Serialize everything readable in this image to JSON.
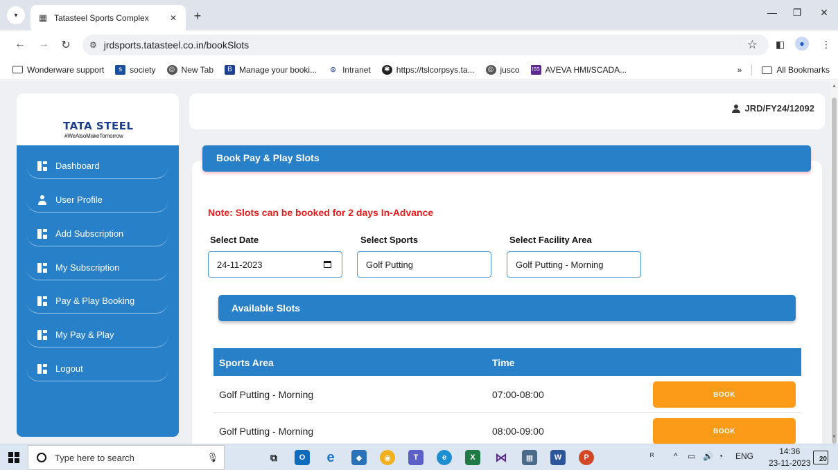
{
  "browser": {
    "tab_title": "Tatasteel Sports Complex",
    "url": "jrdsports.tatasteel.co.in/bookSlots",
    "bookmarks": [
      {
        "label": "Wonderware support",
        "icon": "folder-icon",
        "color": "#444444"
      },
      {
        "label": "society",
        "icon": "society-icon",
        "color": "#1a4fa0"
      },
      {
        "label": "New Tab",
        "icon": "chrome-icon",
        "color": "#555555"
      },
      {
        "label": "Manage your booki...",
        "icon": "booking-icon",
        "color": "#1f3f8f"
      },
      {
        "label": "Intranet",
        "icon": "tata-icon",
        "color": "#1d3d8c"
      },
      {
        "label": "https://tslcorpsys.ta...",
        "icon": "globe-icon",
        "color": "#222222"
      },
      {
        "label": "jusco",
        "icon": "chrome-icon",
        "color": "#555555"
      },
      {
        "label": "AVEVA HMI/SCADA...",
        "icon": "iss-icon",
        "color": "#5b2a8c"
      }
    ],
    "bookmarks_overflow": "»",
    "all_bookmarks": "All Bookmarks"
  },
  "app": {
    "logo": "TATA STEEL",
    "tagline": "#WeAlsoMakeTomorrow",
    "user_id": "JRD/FY24/12092",
    "accent_color": "#2880c8"
  },
  "sidebar": {
    "items": [
      {
        "label": "Dashboard",
        "icon": "grid-icon"
      },
      {
        "label": "User Profile",
        "icon": "user-icon"
      },
      {
        "label": "Add Subscription",
        "icon": "grid-icon"
      },
      {
        "label": "My Subscription",
        "icon": "grid-icon"
      },
      {
        "label": "Pay & Play Booking",
        "icon": "grid-icon"
      },
      {
        "label": "My Pay & Play",
        "icon": "grid-icon"
      },
      {
        "label": "Logout",
        "icon": "grid-icon"
      }
    ]
  },
  "main": {
    "title": "Book Pay & Play Slots",
    "note": "Note: Slots can be booked for 2 days In-Advance",
    "note_color": "#e51c1c",
    "fields": {
      "date_label": "Select Date",
      "date_value": "24-11-2023",
      "sports_label": "Select Sports",
      "sports_value": "Golf Putting",
      "facility_label": "Select Facility Area",
      "facility_value": "Golf Putting - Morning"
    },
    "available_title": "Available Slots",
    "table": {
      "columns": [
        "Sports Area",
        "Time"
      ],
      "rows": [
        {
          "area": "Golf Putting - Morning",
          "time": "07:00-08:00",
          "action": "BOOK"
        },
        {
          "area": "Golf Putting - Morning",
          "time": "08:00-09:00",
          "action": "BOOK"
        }
      ]
    },
    "book_color": "#fb9b17"
  },
  "taskbar": {
    "search_placeholder": "Type here to search",
    "time": "14:36",
    "date": "23-11-2023",
    "language": "ENG",
    "notifications": "20"
  }
}
